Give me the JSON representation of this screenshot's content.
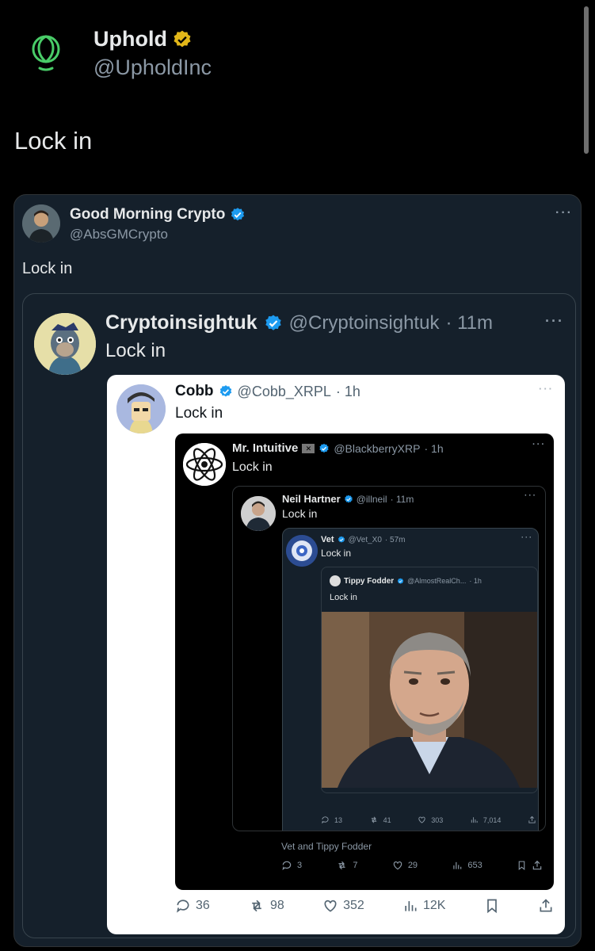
{
  "post": {
    "author_name": "Uphold",
    "author_handle": "@UpholdInc",
    "text": "Lock in"
  },
  "level1": {
    "author_name": "Good Morning Crypto",
    "author_handle": "@AbsGMCrypto",
    "text": "Lock in",
    "more": "···"
  },
  "level2": {
    "author_name": "Cryptoinsightuk",
    "author_handle": "@Cryptoinsightuk",
    "time": "· 11m",
    "text": "Lock in",
    "more": "···"
  },
  "level3": {
    "author_name": "Cobb",
    "author_handle": "@Cobb_XRPL",
    "time": "· 1h",
    "text": "Lock in",
    "more": "···",
    "stats": {
      "replies": "36",
      "reposts": "98",
      "likes": "352",
      "views": "12K"
    }
  },
  "level4": {
    "author_name": "Mr. Intuitive",
    "author_handle": "@BlackberryXRP",
    "time": "· 1h",
    "text": "Lock in",
    "more": "···",
    "footer_text": "Vet and Tippy Fodder",
    "stats": {
      "replies": "3",
      "reposts": "7",
      "likes": "29",
      "views": "653"
    }
  },
  "level5": {
    "author_name": "Neil Hartner",
    "author_handle": "@illneil",
    "time": "· 11m",
    "text": "Lock in",
    "more": "···"
  },
  "level6": {
    "author_name": "Vet",
    "author_handle": "@Vet_X0",
    "time": "· 57m",
    "text": "Lock in",
    "more": "···",
    "stats": {
      "replies": "13",
      "reposts": "41",
      "likes": "303",
      "views": "7,014"
    }
  },
  "level7": {
    "author_name": "Tippy Fodder",
    "author_handle": "@AlmostRealCh...",
    "time": "· 1h",
    "text": "Lock in"
  },
  "colors": {
    "background": "#000000",
    "card_dark": "#15202b",
    "card_light": "#ffffff",
    "verified_blue": "#1d9bf0",
    "verified_gold": "#e2b719",
    "brand_green": "#49cc68"
  }
}
